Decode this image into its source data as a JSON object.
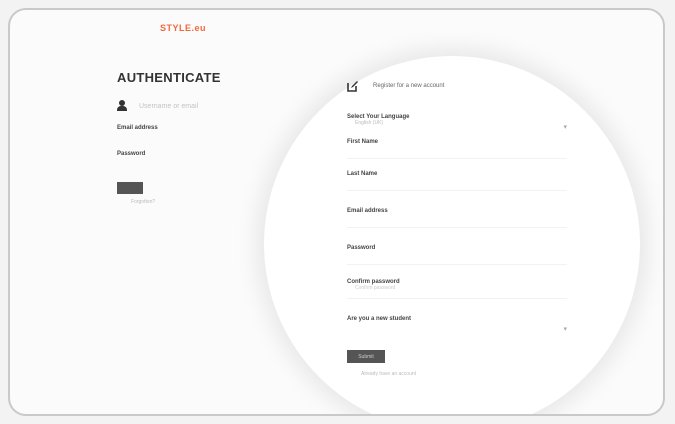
{
  "brand": {
    "logo_text": "STYLE.eu"
  },
  "auth": {
    "title": "AUTHENTICATE",
    "username_placeholder": "Username or email",
    "email_label": "Email address",
    "password_label": "Password",
    "login_label": "",
    "forgot_label": "Forgotten?"
  },
  "register": {
    "header": "Register for a new account",
    "language_label": "Select Your Language",
    "language_value": "English (UK)",
    "first_name_label": "First Name",
    "last_name_label": "Last Name",
    "email_label": "Email address",
    "password_label": "Password",
    "confirm_password_label": "Confirm password",
    "confirm_password_placeholder": "Confirm password",
    "student_label": "Are you a new student",
    "student_value": "",
    "submit_label": "Submit",
    "note_text": "Already have an account"
  },
  "colors": {
    "brand": "#f0693c",
    "button": "#555555"
  }
}
